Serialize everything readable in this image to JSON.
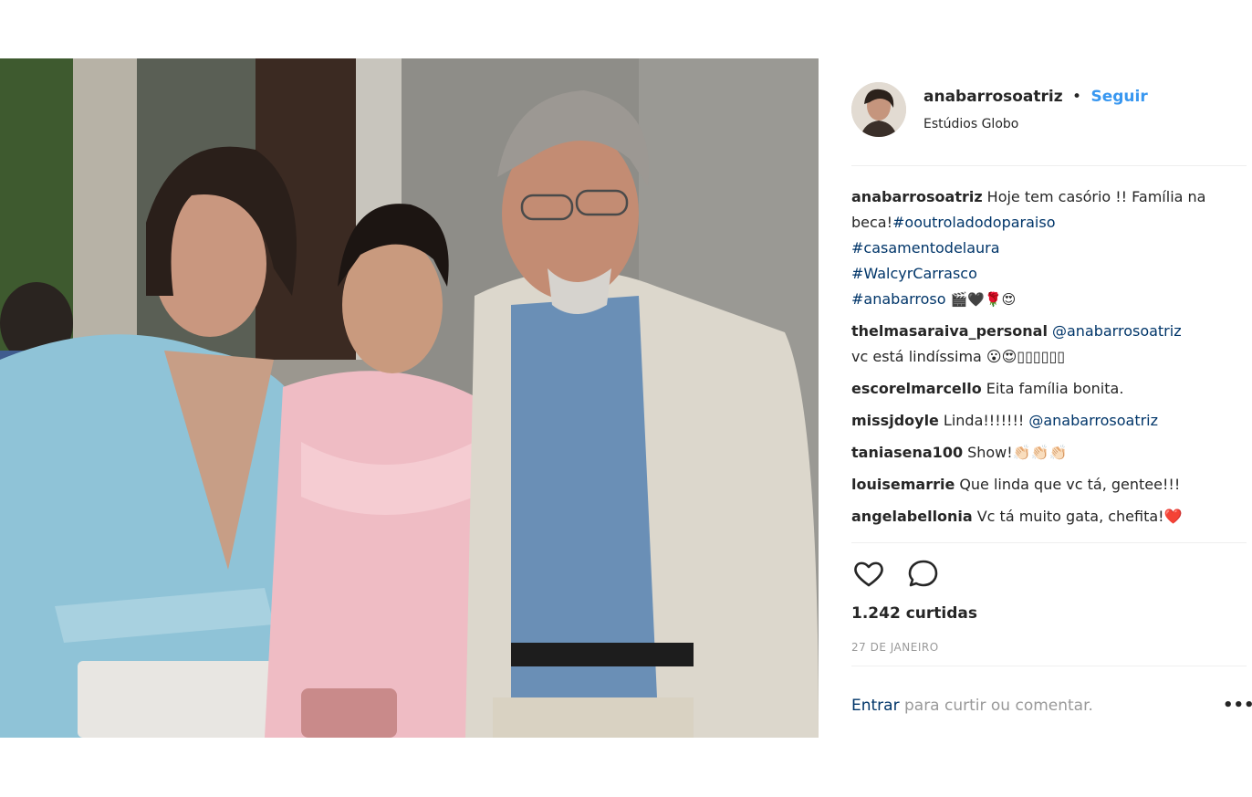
{
  "post": {
    "photo_alt": "",
    "owner": "anabarrosoatriz",
    "separator": "•",
    "follow_label": "Seguir",
    "location": "Estúdios Globo",
    "caption": {
      "user": "anabarrosoatriz",
      "text": "Hoje tem casório !! Família na beca!",
      "tags": [
        "#ooutroladodoparaiso",
        "#casamentodelaura",
        "#WalcyrCarrasco",
        "#anabarroso"
      ],
      "emojis": "🎬🖤🌹😍"
    },
    "comments": [
      {
        "user": "thelmasaraiva_personal",
        "mention": "@anabarrosoatriz",
        "text": "vc está lindíssima 😮😍▯▯▯▯▯▯"
      },
      {
        "user": "escorelmarcello",
        "text": "Eita família bonita."
      },
      {
        "user": "missjdoyle",
        "text": "Linda!!!!!!!",
        "mention": "@anabarrosoatriz"
      },
      {
        "user": "taniasena100",
        "text": "Show!👏🏻👏🏻👏🏻"
      },
      {
        "user": "louisemarrie",
        "text": "Que linda que vc tá, gentee!!!"
      },
      {
        "user": "angelabellonia",
        "text": "Vc tá muito gata, chefita!❤️"
      }
    ],
    "likes": "1.242 curtidas",
    "date": "27 DE JANEIRO",
    "login_link": "Entrar",
    "login_text": " para curtir ou comentar.",
    "more_label": "•••",
    "icons": {
      "like": "heart-icon",
      "comment": "comment-bubble-icon"
    },
    "colors": {
      "link": "#003569",
      "follow": "#3897f0",
      "muted": "#999999"
    }
  }
}
